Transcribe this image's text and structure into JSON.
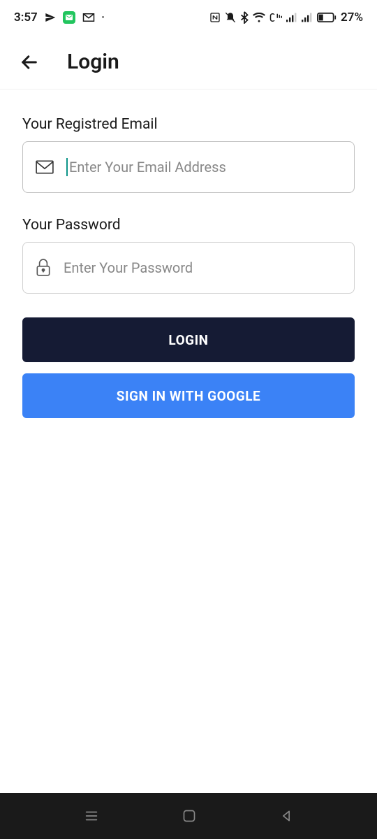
{
  "status_bar": {
    "time": "3:57",
    "battery_percent": "27%"
  },
  "app_bar": {
    "title": "Login"
  },
  "form": {
    "email_label": "Your Registred Email",
    "email_placeholder": "Enter Your Email Address",
    "password_label": "Your Password",
    "password_placeholder": "Enter Your Password"
  },
  "buttons": {
    "login": "LOGIN",
    "google": "SIGN IN WITH GOOGLE"
  }
}
